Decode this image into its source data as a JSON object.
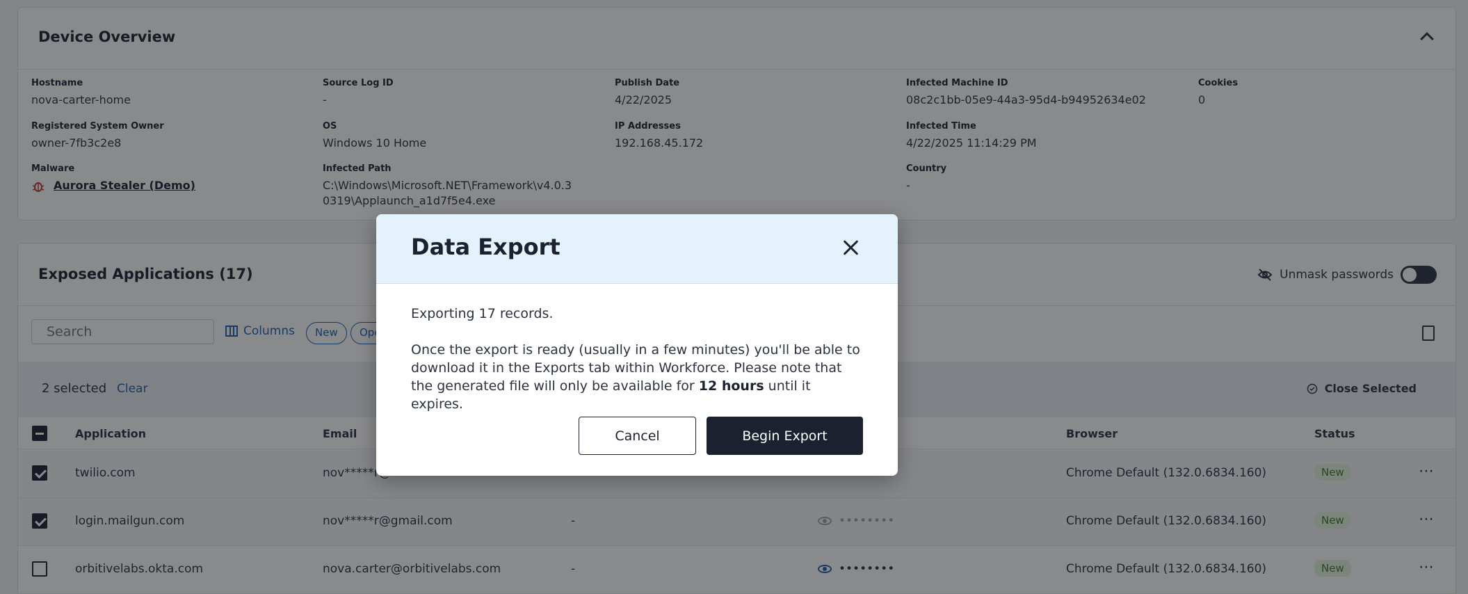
{
  "device_overview": {
    "title": "Device Overview",
    "fields": {
      "hostname": {
        "label": "Hostname",
        "value": "nova-carter-home"
      },
      "source_log_id": {
        "label": "Source Log ID",
        "value": "-"
      },
      "publish_date": {
        "label": "Publish Date",
        "value": "4/22/2025"
      },
      "infected_machine_id": {
        "label": "Infected Machine ID",
        "value": "08c2c1bb-05e9-44a3-95d4-b94952634e02"
      },
      "cookies": {
        "label": "Cookies",
        "value": "0"
      },
      "registered_owner": {
        "label": "Registered System Owner",
        "value": "owner-7fb3c2e8"
      },
      "os": {
        "label": "OS",
        "value": "Windows 10 Home"
      },
      "ip_addresses": {
        "label": "IP Addresses",
        "value": "192.168.45.172"
      },
      "infected_time": {
        "label": "Infected Time",
        "value": "4/22/2025 11:14:29 PM"
      },
      "malware": {
        "label": "Malware",
        "value": "Aurora Stealer (Demo)"
      },
      "infected_path": {
        "label": "Infected Path",
        "value_line1": "C:\\Windows\\Microsoft.NET\\Framework\\v4.0.3",
        "value_line2": "0319\\Applaunch_a1d7f5e4.exe"
      },
      "country": {
        "label": "Country",
        "value": "-"
      }
    }
  },
  "exposed_apps": {
    "title": "Exposed Applications (17)",
    "unmask_label": "Unmask passwords",
    "search_placeholder": "Search",
    "columns_label": "Columns",
    "chips": [
      "New",
      "Ope"
    ],
    "selected_text": "2 selected",
    "clear_label": "Clear",
    "close_selected_label": "Close Selected",
    "headers": [
      "Application",
      "Email",
      "Browser",
      "Status"
    ],
    "rows": [
      {
        "application": "twilio.com",
        "email": "nov*****r@",
        "url": "",
        "password": "",
        "browser": "Chrome Default (132.0.6834.160)",
        "status": "New",
        "checked": true
      },
      {
        "application": "login.mailgun.com",
        "email": "nov*****r@gmail.com",
        "url": "-",
        "password": "••••••••",
        "browser": "Chrome Default (132.0.6834.160)",
        "status": "New",
        "checked": true
      },
      {
        "application": "orbitivelabs.okta.com",
        "email": "nova.carter@orbitivelabs.com",
        "url": "-",
        "password": "••••••••",
        "browser": "Chrome Default (132.0.6834.160)",
        "status": "New",
        "checked": false
      }
    ]
  },
  "modal": {
    "title": "Data Export",
    "line1": "Exporting 17 records.",
    "para_before": "Once the export is ready (usually in a few minutes) you'll be able to download it in the Exports tab within Workforce. Please note that the generated file will only be available for ",
    "bold": "12 hours",
    "para_after": " until it expires.",
    "cancel_label": "Cancel",
    "begin_label": "Begin Export"
  },
  "colors": {
    "accent": "#1f5fa8",
    "dark": "#1c2130",
    "status_new_bg": "#e4f5dc",
    "status_new_fg": "#3c7a25",
    "modal_header": "#e4f2fb",
    "malware_icon": "#c0392b"
  }
}
